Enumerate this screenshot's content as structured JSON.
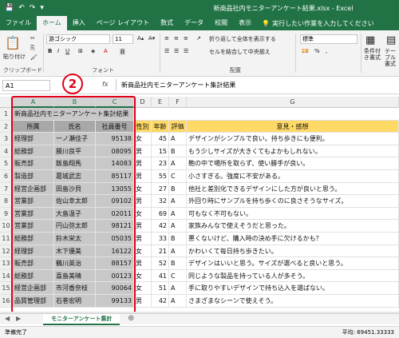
{
  "title_bar": {
    "title": "新商品社内モニターアンケート結果.xlsx  -  Excel"
  },
  "ribbon_tabs": [
    "ファイル",
    "ホーム",
    "挿入",
    "ページ レイアウト",
    "数式",
    "データ",
    "校閲",
    "表示"
  ],
  "tell_me": "実行したい作業を入力してください",
  "ribbon": {
    "paste": "貼り付け",
    "clipboard": "クリップボード",
    "font_name": "游ゴシック",
    "font_size": "11",
    "font_group": "フォント",
    "wrap_text": "折り返して全体を表示する",
    "merge_center": "セルを結合して中央揃え",
    "align_group": "配置",
    "number_format": "標準",
    "cond_format": "条件付き書式",
    "table_format": "テーブル書式"
  },
  "formula_bar": {
    "name_box": "A1",
    "fx": "fx",
    "formula": "新商品社内モニターアンケート集計結果"
  },
  "columns": [
    "A",
    "B",
    "C",
    "D",
    "E",
    "F",
    "G"
  ],
  "sheet_title": "新商品社内モニターアンケート集計結果",
  "headers": [
    "所属",
    "氏名",
    "社員番号",
    "性別",
    "年齢",
    "評価",
    "意見・感想"
  ],
  "rows": [
    [
      "経理部",
      "一ノ瀬佳子",
      "95138",
      "女",
      "45",
      "A",
      "デザインがシンプルで良い。持ち歩きにも便利。"
    ],
    [
      "総務部",
      "勝川良平",
      "08095",
      "男",
      "15",
      "B",
      "もう少しサイズが大きくてもよかもしれない。"
    ],
    [
      "販売部",
      "飯島翔馬",
      "14083",
      "男",
      "23",
      "A",
      "鞄の中で場所を取らず、使い勝手が良い。"
    ],
    [
      "製造部",
      "葛城武志",
      "85117",
      "男",
      "55",
      "C",
      "小さすぎる。強度に不安がある。"
    ],
    [
      "経営企画部",
      "田島沙貝",
      "13055",
      "女",
      "27",
      "B",
      "他社と差別化できるデザインにした方が良いと思う。"
    ],
    [
      "営業部",
      "佐山幸太郎",
      "09102",
      "男",
      "32",
      "A",
      "外回り時にサンプルを持ち歩くのに良さそうなサイズ。"
    ],
    [
      "営業部",
      "大島温子",
      "02011",
      "女",
      "69",
      "A",
      "可もなく不可もない。"
    ],
    [
      "営業部",
      "円山弥太郎",
      "98121",
      "男",
      "42",
      "A",
      "家族みんなで使えそうだと思った。"
    ],
    [
      "総務部",
      "鈴木栄太",
      "05035",
      "男",
      "33",
      "B",
      "悪くないけど、購入時の決め手に欠けるかも？"
    ],
    [
      "経理部",
      "木下優美",
      "16122",
      "女",
      "21",
      "A",
      "かわいくて毎日持ち歩きたい。"
    ],
    [
      "販売部",
      "鶴川英治",
      "88157",
      "男",
      "52",
      "B",
      "デザインはいいと思う。サイズが選べると良いと思う。"
    ],
    [
      "総務部",
      "喜島美晴",
      "00123",
      "女",
      "41",
      "C",
      "同じような製品を持っている人が多そう。"
    ],
    [
      "経営企画部",
      "市河香奈枝",
      "90064",
      "女",
      "51",
      "A",
      "手に取りやすいデザインで持ち込入を選ばない。"
    ],
    [
      "品質管理部",
      "石巻宏明",
      "99133",
      "男",
      "42",
      "A",
      "さまざまなシーンで使えそう。"
    ]
  ],
  "badge": "2",
  "sheet_tab": "モニターアンケート集計",
  "status": {
    "ready": "準備完了",
    "average": "平均: 69451.33333"
  }
}
